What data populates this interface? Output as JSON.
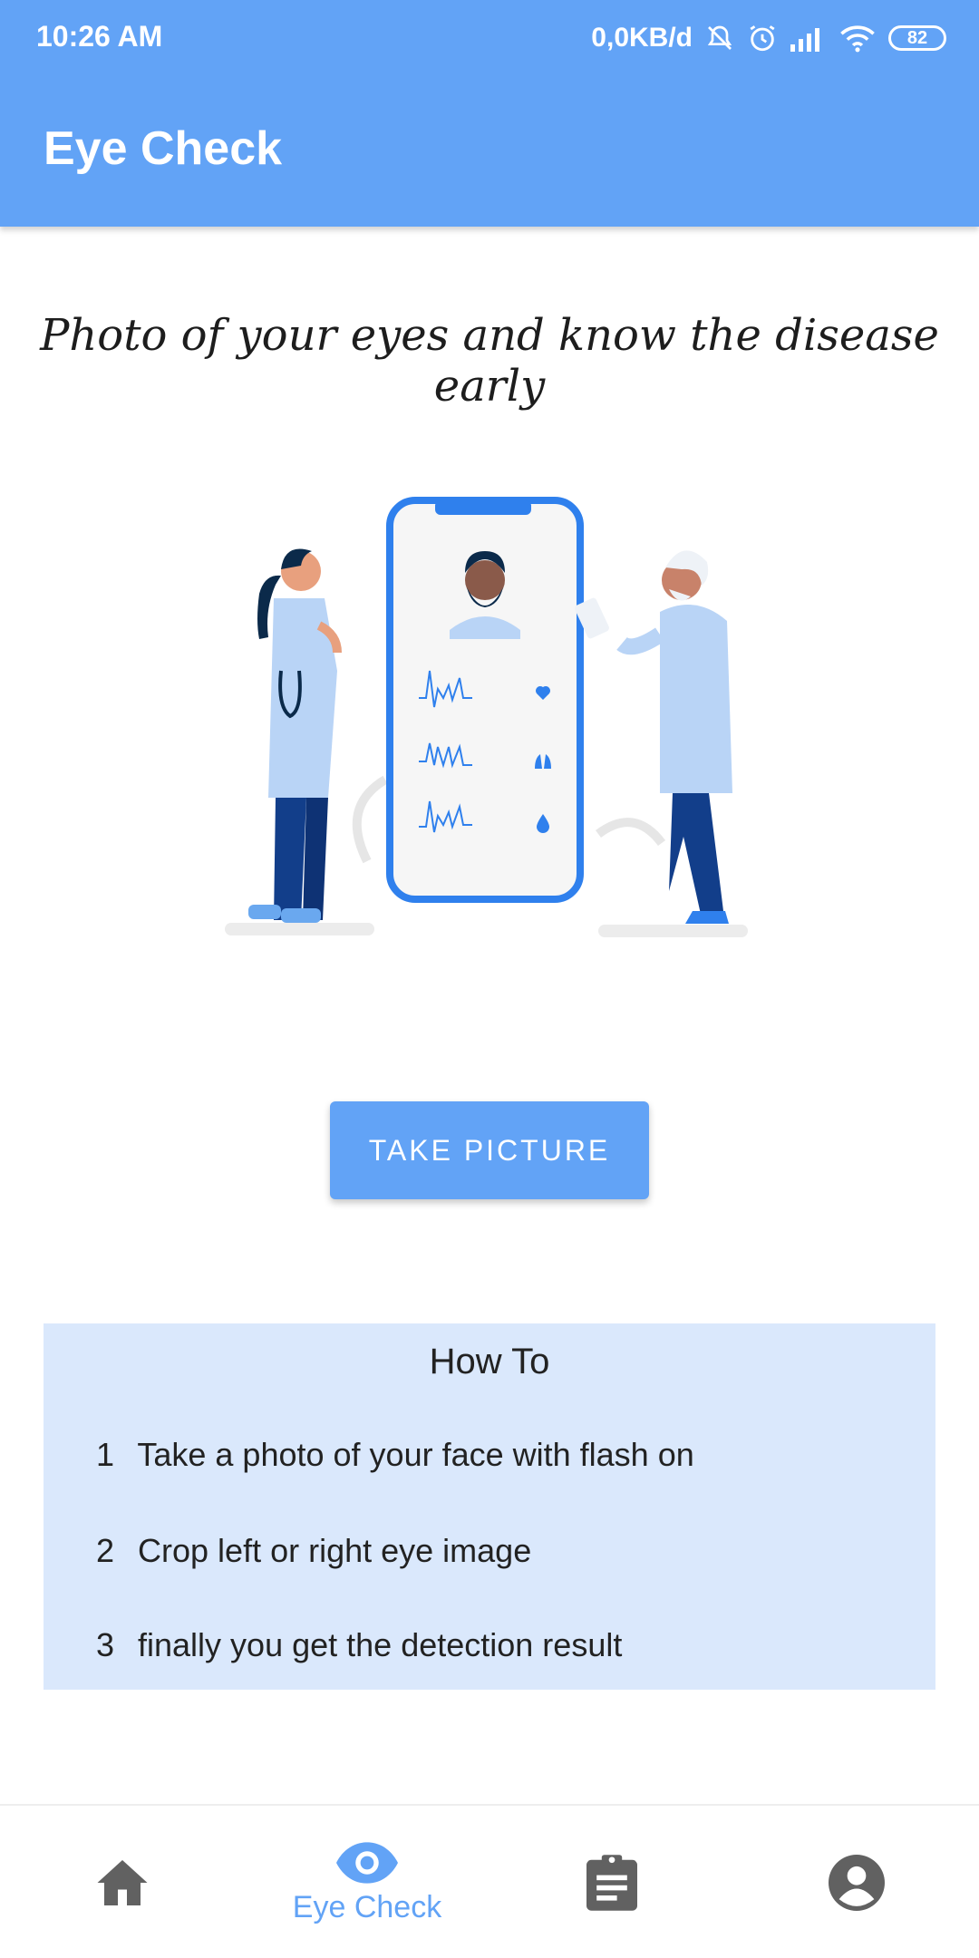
{
  "status_bar": {
    "time": "10:26 AM",
    "network_speed": "0,0KB/d",
    "battery": "82",
    "icons": [
      "bell-off-icon",
      "alarm-icon",
      "signal-icon",
      "wifi-icon",
      "battery-icon"
    ]
  },
  "app_bar": {
    "title": "Eye Check"
  },
  "main": {
    "tagline": "Photo of your eyes and know the disease early",
    "take_picture_label": "TAKE PICTURE"
  },
  "howto": {
    "title": "How To",
    "steps": [
      {
        "num": "1",
        "text": "Take a photo of your face with flash on"
      },
      {
        "num": "2",
        "text": "Crop left or right eye image"
      },
      {
        "num": "3",
        "text": "finally you get the detection result"
      }
    ]
  },
  "bottom_nav": {
    "items": [
      {
        "icon": "home-icon",
        "label": ""
      },
      {
        "icon": "eye-icon",
        "label": "Eye Check",
        "active": true
      },
      {
        "icon": "clipboard-icon",
        "label": ""
      },
      {
        "icon": "account-icon",
        "label": ""
      }
    ]
  },
  "colors": {
    "primary": "#62a3f6",
    "howto_bg": "#dae8fc",
    "nav_inactive": "#616161"
  }
}
